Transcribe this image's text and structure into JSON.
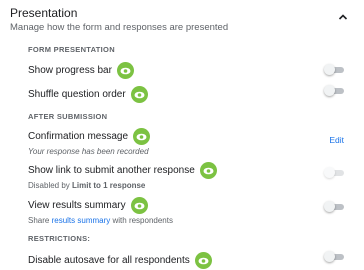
{
  "header": {
    "title": "Presentation",
    "subtitle": "Manage how the form and responses are presented",
    "collapse_icon": "chevron-up-icon"
  },
  "sections": {
    "form_presentation": "FORM PRESENTATION",
    "after_submission": "AFTER SUBMISSION",
    "restrictions": "RESTRICTIONS:"
  },
  "rows": {
    "progress_bar": {
      "title": "Show progress bar",
      "enabled": false
    },
    "shuffle": {
      "title": "Shuffle question order",
      "enabled": false
    },
    "confirmation": {
      "title": "Confirmation message",
      "subtitle": "Your response has been recorded",
      "action": "Edit"
    },
    "another_response": {
      "title": "Show link to submit another response",
      "sub_prefix": "Disabled by ",
      "sub_bold": "Limit to 1 response",
      "enabled": false,
      "disabled": true
    },
    "results_summary": {
      "title": "View results summary",
      "sub_prefix": "Share ",
      "sub_link": "results summary",
      "sub_suffix": " with respondents",
      "enabled": false
    },
    "autosave": {
      "title": "Disable autosave for all respondents",
      "enabled": false
    }
  },
  "colors": {
    "accent_link": "#1a73e8",
    "eye_badge": "#7cc242",
    "toggle_off_track": "#bdc1c6"
  },
  "icons": {
    "eye_badge": "eye-icon"
  }
}
